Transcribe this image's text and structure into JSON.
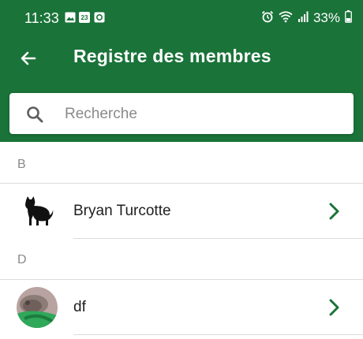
{
  "status_bar": {
    "time": "11:33",
    "notification_icons": [
      "image-icon",
      "calendar-icon",
      "app-notification-icon"
    ],
    "calendar_day": "23",
    "battery": "33%",
    "icons": [
      "alarm-icon",
      "wifi-icon",
      "signal-icon",
      "battery-icon"
    ]
  },
  "toolbar": {
    "title": "Registre des membres",
    "back_icon": "arrow-left-icon"
  },
  "search": {
    "placeholder": "Recherche",
    "value": "",
    "icon": "search-icon"
  },
  "sections": [
    {
      "letter": "B",
      "members": [
        {
          "name": "Bryan Turcotte",
          "avatar": "cat-silhouette"
        }
      ]
    },
    {
      "letter": "D",
      "members": [
        {
          "name": "df",
          "avatar": "photo"
        }
      ]
    }
  ],
  "colors": {
    "header": "#1a7339",
    "accent_chevron": "#1a7339",
    "divider": "#dcdcdc",
    "section_text": "#8a8a8a"
  }
}
